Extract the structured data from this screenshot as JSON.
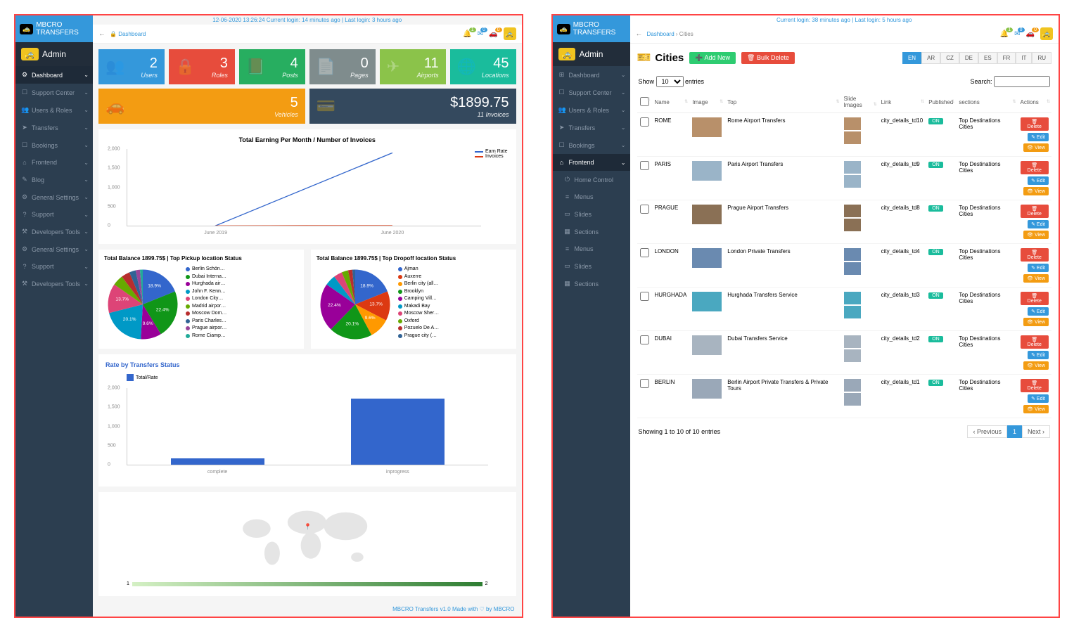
{
  "brand": "MBCRO TRANSFERS",
  "admin_label": "Admin",
  "left": {
    "top_info": "12-06-2020 13:26:24 Current login: 14 minutes ago | Last login: 3 hours ago",
    "breadcrumb_home": "Dashboard",
    "nav": [
      {
        "label": "Dashboard",
        "active": true,
        "icon": "⚙"
      },
      {
        "label": "Support Center",
        "icon": "☐"
      },
      {
        "label": "Users & Roles",
        "icon": "👥"
      },
      {
        "label": "Transfers",
        "icon": "➤"
      },
      {
        "label": "Bookings",
        "icon": "☐"
      },
      {
        "label": "Frontend",
        "icon": "⌂"
      },
      {
        "label": "Blog",
        "icon": "✎"
      },
      {
        "label": "General Settings",
        "icon": "⚙"
      },
      {
        "label": "Support",
        "icon": "?"
      },
      {
        "label": "Developers Tools",
        "icon": "⚒"
      },
      {
        "label": "General Settings",
        "icon": "⚙"
      },
      {
        "label": "Support",
        "icon": "?"
      },
      {
        "label": "Developers Tools",
        "icon": "⚒"
      }
    ],
    "stats": [
      {
        "num": "2",
        "lbl": "Users",
        "icon": "👥",
        "cls": "c-blue"
      },
      {
        "num": "3",
        "lbl": "Roles",
        "icon": "🔒",
        "cls": "c-red"
      },
      {
        "num": "4",
        "lbl": "Posts",
        "icon": "📕",
        "cls": "c-green"
      },
      {
        "num": "0",
        "lbl": "Pages",
        "icon": "📄",
        "cls": "c-grey"
      },
      {
        "num": "11",
        "lbl": "Airports",
        "icon": "✈",
        "cls": "c-lgreen"
      },
      {
        "num": "45",
        "lbl": "Locations",
        "icon": "🌐",
        "cls": "c-teal"
      },
      {
        "num": "5",
        "lbl": "Vehicles",
        "icon": "🚗",
        "cls": "c-orange"
      },
      {
        "num": "$1899.75",
        "lbl": "11 Invoices",
        "icon": "💳",
        "cls": "c-dark"
      }
    ],
    "chart_data": [
      {
        "type": "line",
        "title": "Total Earning Per Month / Number of Invoices",
        "x": [
          "June 2019",
          "June 2020"
        ],
        "ylim": [
          0,
          2000
        ],
        "yticks": [
          0,
          500,
          1000,
          1500,
          2000
        ],
        "series": [
          {
            "name": "Earn Rate",
            "color": "#3366cc",
            "values": [
              0,
              1900
            ]
          },
          {
            "name": "Invoices",
            "color": "#dc3912",
            "values": [
              0,
              11
            ]
          }
        ]
      },
      {
        "type": "pie",
        "title": "Total Balance 1899.75$ | Top Pickup location Status",
        "slices": [
          {
            "label": "Berlin Schön…",
            "pct": 18.9,
            "color": "#3366cc"
          },
          {
            "label": "Dubai Interna…",
            "pct": 22.4,
            "color": "#109618"
          },
          {
            "label": "Hurghada air…",
            "pct": 9.6,
            "color": "#990099"
          },
          {
            "label": "John F. Kenn…",
            "pct": 20.1,
            "color": "#0099c6"
          },
          {
            "label": "London City…",
            "pct": 13.7,
            "color": "#dd4477"
          },
          {
            "label": "Madrid airpor…",
            "pct": 5,
            "color": "#66aa00"
          },
          {
            "label": "Moscow Dom…",
            "pct": 4,
            "color": "#b82e2e"
          },
          {
            "label": "Paris Charles…",
            "pct": 3,
            "color": "#316395"
          },
          {
            "label": "Prague airpor…",
            "pct": 2,
            "color": "#994499"
          },
          {
            "label": "Rome Ciamp…",
            "pct": 1.3,
            "color": "#22aa99"
          }
        ]
      },
      {
        "type": "pie",
        "title": "Total Balance 1899.75$ | Top Dropoff location Status",
        "slices": [
          {
            "label": "Ajman",
            "pct": 18.9,
            "color": "#3366cc"
          },
          {
            "label": "Auxerre",
            "pct": 13.7,
            "color": "#dc3912"
          },
          {
            "label": "Berlin city (all…",
            "pct": 9.6,
            "color": "#ff9900"
          },
          {
            "label": "Brooklyn",
            "pct": 20.1,
            "color": "#109618"
          },
          {
            "label": "Camping Vill…",
            "pct": 22.4,
            "color": "#990099"
          },
          {
            "label": "Makadi Bay",
            "pct": 5,
            "color": "#0099c6"
          },
          {
            "label": "Moscow Sher…",
            "pct": 4,
            "color": "#dd4477"
          },
          {
            "label": "Oxford",
            "pct": 3,
            "color": "#66aa00"
          },
          {
            "label": "Pozuelo De A…",
            "pct": 2,
            "color": "#b82e2e"
          },
          {
            "label": "Prague city (…",
            "pct": 1.3,
            "color": "#316395"
          }
        ]
      },
      {
        "type": "bar",
        "title": "Rate by Transfers Status",
        "legend": "Total/Rate",
        "categories": [
          "complete",
          "inprogress"
        ],
        "values": [
          170,
          1730
        ],
        "ylim": [
          0,
          2000
        ],
        "yticks": [
          0,
          500,
          1000,
          1500,
          2000
        ]
      }
    ],
    "footer": "MBCRO Transfers v1.0 Made with ♡ by MBCRO"
  },
  "right": {
    "top_info": "Current login: 38 minutes ago | Last login: 5 hours ago",
    "breadcrumb_home": "Dashboard",
    "breadcrumb_current": "Cities",
    "page_title": "Cities",
    "add_new": "Add New",
    "bulk_delete": "Bulk Delete",
    "langs": [
      "EN",
      "AR",
      "CZ",
      "DE",
      "ES",
      "FR",
      "IT",
      "RU"
    ],
    "lang_active": "EN",
    "nav": [
      {
        "label": "Dashboard",
        "icon": "⊞"
      },
      {
        "label": "Support Center",
        "icon": "☐"
      },
      {
        "label": "Users & Roles",
        "icon": "👥"
      },
      {
        "label": "Transfers",
        "icon": "➤"
      },
      {
        "label": "Bookings",
        "icon": "☐"
      },
      {
        "label": "Frontend",
        "icon": "⌂",
        "active": true
      },
      {
        "label": "Home Control",
        "icon": "⏻",
        "sub": true
      },
      {
        "label": "Menus",
        "icon": "≡",
        "sub": true
      },
      {
        "label": "Slides",
        "icon": "▭",
        "sub": true
      },
      {
        "label": "Sections",
        "icon": "▦",
        "sub": true
      },
      {
        "label": "Menus",
        "icon": "≡",
        "sub": true
      },
      {
        "label": "Slides",
        "icon": "▭",
        "sub": true
      },
      {
        "label": "Sections",
        "icon": "▦",
        "sub": true
      }
    ],
    "show_label": "Show",
    "entries_label": "entries",
    "entries_value": "10",
    "search_label": "Search:",
    "columns": [
      "",
      "Name",
      "Image",
      "Top",
      "Slide Images",
      "Link",
      "Published",
      "sections",
      "Actions"
    ],
    "rows": [
      {
        "name": "ROME",
        "top": "Rome Airport Transfers",
        "link": "city_details_td10",
        "pub": "ON",
        "sections": "Top Destinations Cities"
      },
      {
        "name": "PARIS",
        "top": "Paris Airport Transfers",
        "link": "city_details_td9",
        "pub": "ON",
        "sections": "Top Destinations Cities"
      },
      {
        "name": "PRAGUE",
        "top": "Prague Airport Transfers",
        "link": "city_details_td8",
        "pub": "ON",
        "sections": "Top Destinations Cities"
      },
      {
        "name": "LONDON",
        "top": "London Private Transfers",
        "link": "city_details_td4",
        "pub": "ON",
        "sections": "Top Destinations Cities"
      },
      {
        "name": "HURGHADA",
        "top": "Hurghada Transfers Service",
        "link": "city_details_td3",
        "pub": "ON",
        "sections": "Top Destinations Cities"
      },
      {
        "name": "DUBAI",
        "top": "Dubai Transfers Service",
        "link": "city_details_td2",
        "pub": "ON",
        "sections": "Top Destinations Cities"
      },
      {
        "name": "BERLIN",
        "top": "Berlin Airport Private Transfers & Private Tours",
        "link": "city_details_td1",
        "pub": "ON",
        "sections": "Top Destinations Cities"
      }
    ],
    "actions": {
      "delete": "Delete",
      "edit": "Edit",
      "view": "View"
    },
    "table_info": "Showing 1 to 10 of 10 entries",
    "prev": "Previous",
    "next": "Next",
    "page": "1"
  },
  "topbar_badges": {
    "bell": "1",
    "mail": "0",
    "car": "0"
  }
}
